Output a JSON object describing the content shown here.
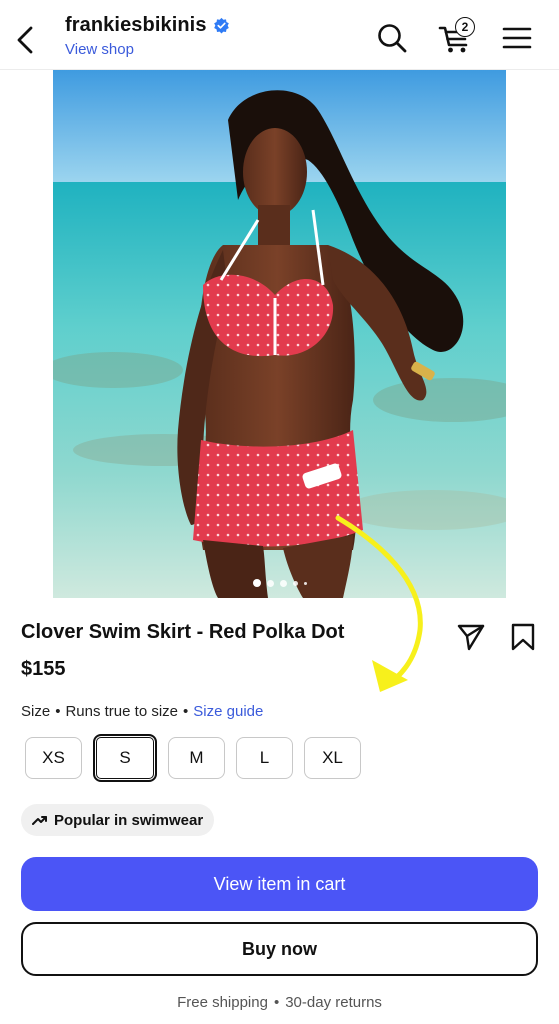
{
  "header": {
    "shop_name": "frankiesbikinis",
    "view_shop": "View shop",
    "cart_count": "2",
    "icons": [
      "back-icon",
      "verified-icon",
      "search-icon",
      "cart-icon",
      "menu-icon"
    ]
  },
  "gallery": {
    "image_count": 5,
    "active_index": 0
  },
  "product": {
    "title": "Clover Swim Skirt - Red Polka Dot",
    "price": "$155"
  },
  "size": {
    "label": "Size",
    "fit_note": "Runs true to size",
    "guide_link": "Size guide",
    "options": [
      "XS",
      "S",
      "M",
      "L",
      "XL"
    ],
    "selected": "S"
  },
  "badge": {
    "popular": "Popular in swimwear"
  },
  "actions": {
    "view_cart": "View item in cart",
    "buy_now": "Buy now"
  },
  "footer": {
    "shipping": "Free shipping",
    "returns": "30-day returns"
  },
  "colors": {
    "accent_blue": "#4b55f6",
    "link_blue": "#3b5bdb",
    "arrow_yellow": "#f7f01c"
  }
}
